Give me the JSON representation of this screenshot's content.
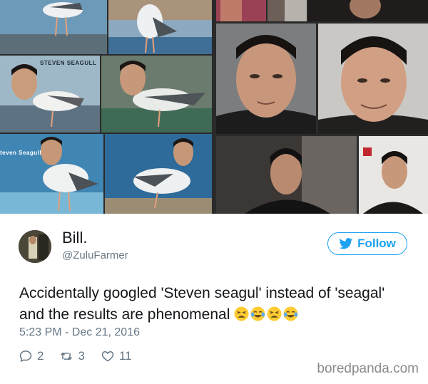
{
  "collage": {
    "captions": {
      "steven_seagull_top": "STEVEN SEAGULL",
      "steven_seagull_left": "teven Seagull"
    }
  },
  "tweet": {
    "display_name": "Bill.",
    "handle": "@ZuluFarmer",
    "follow_label": "Follow",
    "text": "Accidentally googled 'Steven seagul' instead of 'seagal' and the results are phenomenal",
    "emojis": [
      "tired-face-emoji",
      "tears-of-joy-emoji",
      "tired-face-emoji",
      "tears-of-joy-emoji"
    ],
    "timestamp": "5:23 PM - Dec 21, 2016",
    "replies": "2",
    "retweets": "3",
    "likes": "11"
  },
  "watermark": "boredpanda.com",
  "colors": {
    "twitter_blue": "#1da1f2",
    "text_primary": "#14171a",
    "text_secondary": "#657786"
  }
}
